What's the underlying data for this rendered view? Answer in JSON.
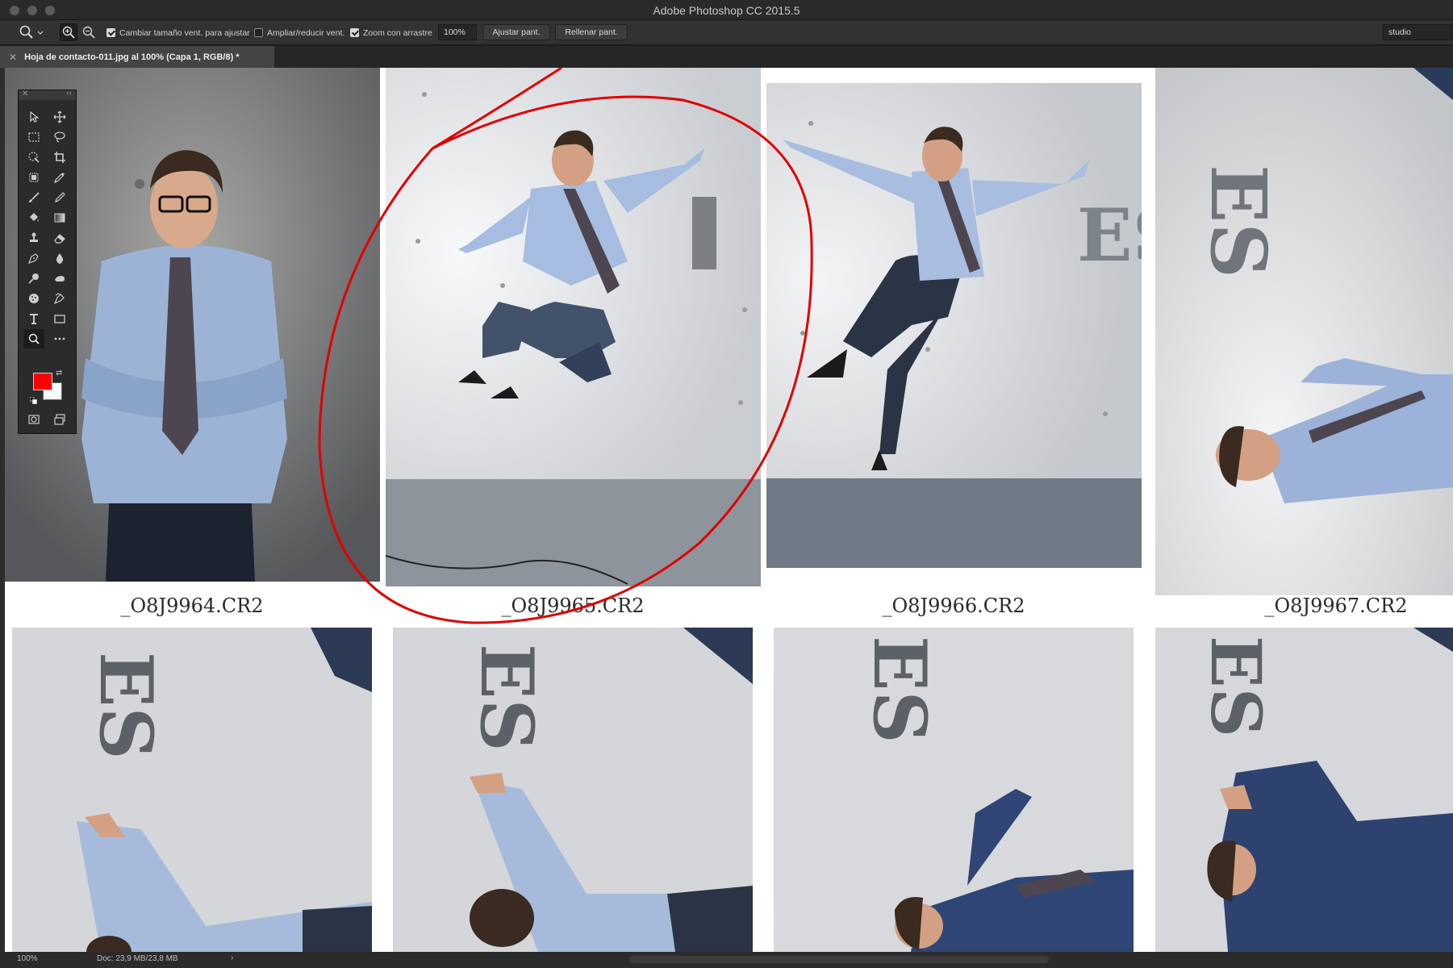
{
  "window": {
    "title": "Adobe Photoshop CC 2015.5"
  },
  "options_bar": {
    "resize_windows_label": "Cambiar tamaño vent. para ajustar",
    "zoom_all_windows_label": "Ampliar/reducir vent.",
    "scrubby_zoom_label": "Zoom con arrastre",
    "zoom_value": "100%",
    "fit_screen_label": "Ajustar pant.",
    "fill_screen_label": "Rellenar pant.",
    "workspace": "studio"
  },
  "document_tab": {
    "title": "Hoja de contacto-011.jpg al 100% (Capa 1, RGB/8) *"
  },
  "contact_sheet": {
    "captions": [
      "_O8J9964.CR2",
      "_O8J9965.CR2",
      "_O8J9966.CR2",
      "_O8J9967.CR2"
    ]
  },
  "tools_panel": {
    "tools": [
      "move-select",
      "move",
      "marquee",
      "lasso",
      "quick-select",
      "crop",
      "frame",
      "eyedropper",
      "brush",
      "pencil",
      "paint-bucket",
      "gradient",
      "stamp",
      "eraser",
      "pen",
      "blur",
      "dodge",
      "smudge",
      "sponge",
      "path-select",
      "type",
      "rectangle",
      "zoom",
      "more",
      "quick-mask",
      "screen-mode"
    ],
    "foreground_color": "#ff0000",
    "background_color": "#ffffff"
  },
  "status_bar": {
    "zoom": "100%",
    "doc_size": "Doc: 23,9 MB/23,8 MB",
    "arrow": "›"
  },
  "colors": {
    "annotation_circle": "#e00000"
  }
}
